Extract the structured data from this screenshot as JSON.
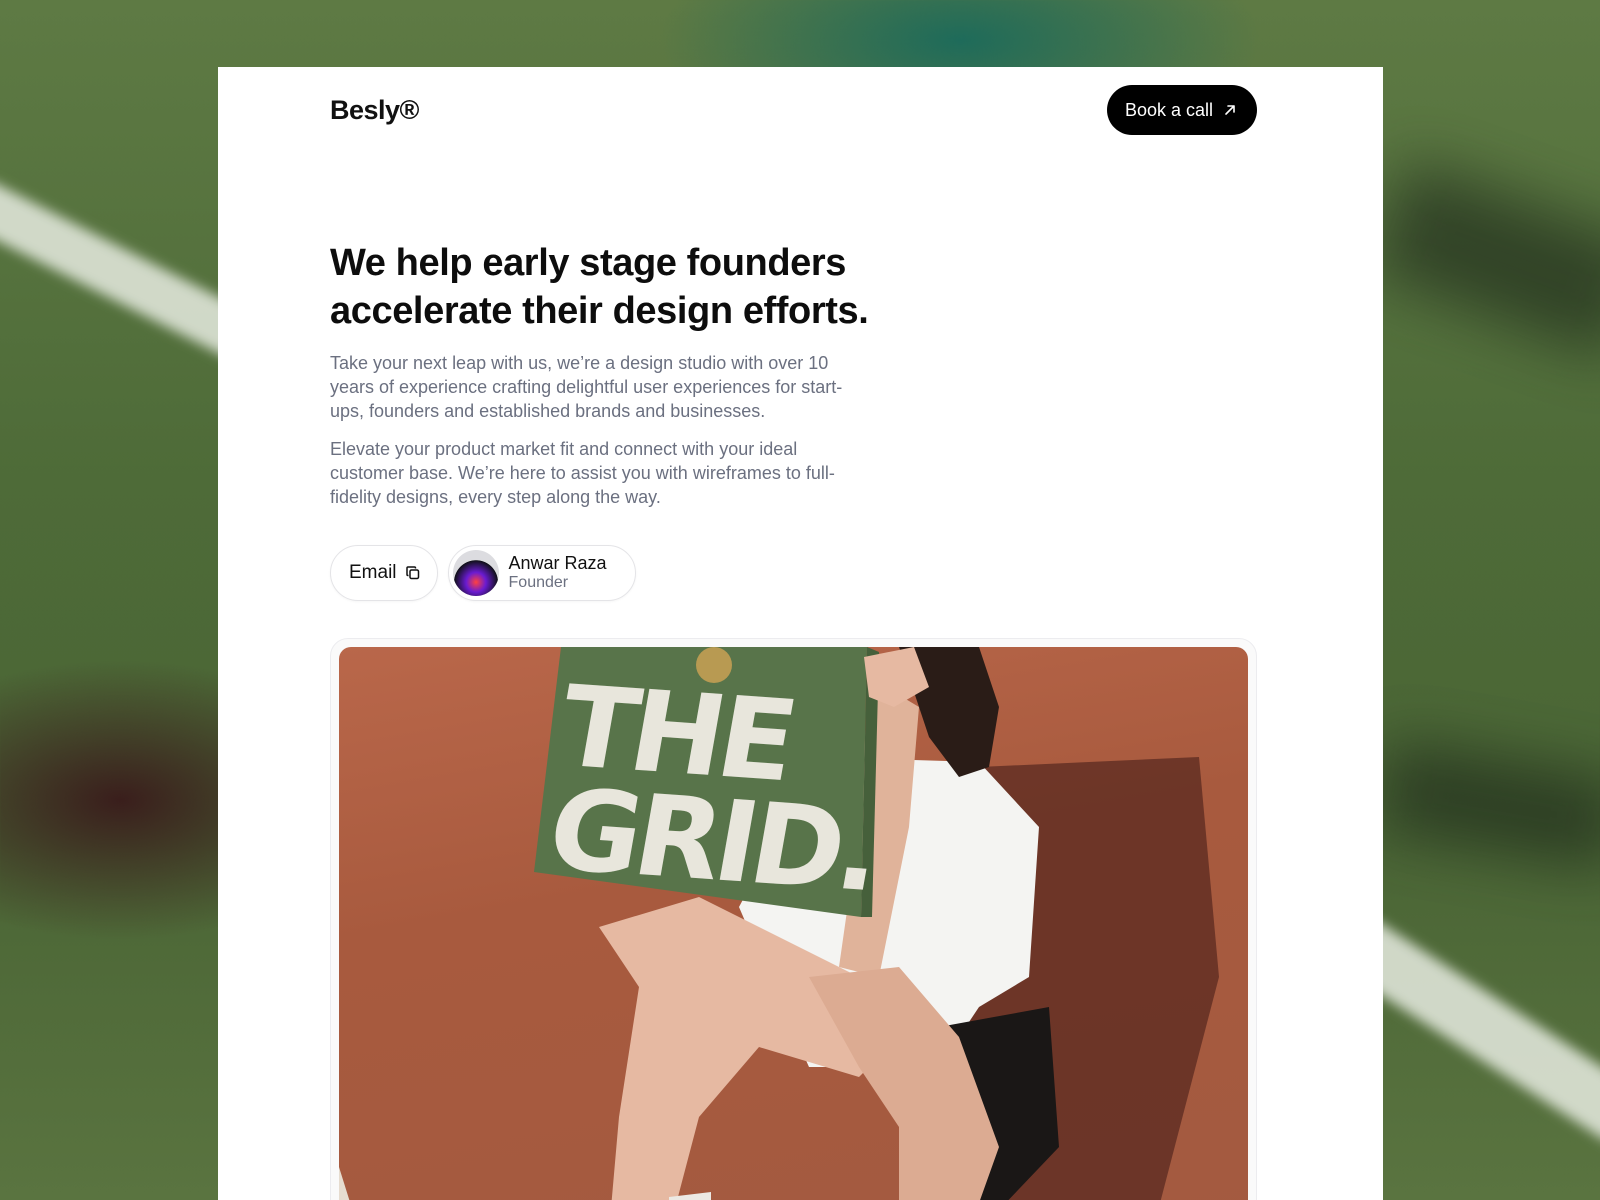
{
  "header": {
    "logo": "Besly®",
    "cta_label": "Book a call"
  },
  "hero": {
    "headline": "We help early stage founders accelerate their design efforts.",
    "paragraph_1": "Take your next leap with us, we’re a design studio with over 10 years of experience crafting delightful user experiences for start-ups, founders and established brands and businesses.",
    "paragraph_2": "Elevate your product market fit and connect with your ideal customer base. We’re here to assist you with wireframes to full-fidelity designs, every step along the way."
  },
  "contacts": {
    "email_label": "Email",
    "person_name": "Anwar Raza",
    "person_role": "Founder"
  },
  "photo": {
    "magazine_line_1": "THE",
    "magazine_line_2": "GRID."
  },
  "icons": {
    "cta_icon": "arrow-up-right-icon",
    "email_icon": "copy-icon"
  }
}
